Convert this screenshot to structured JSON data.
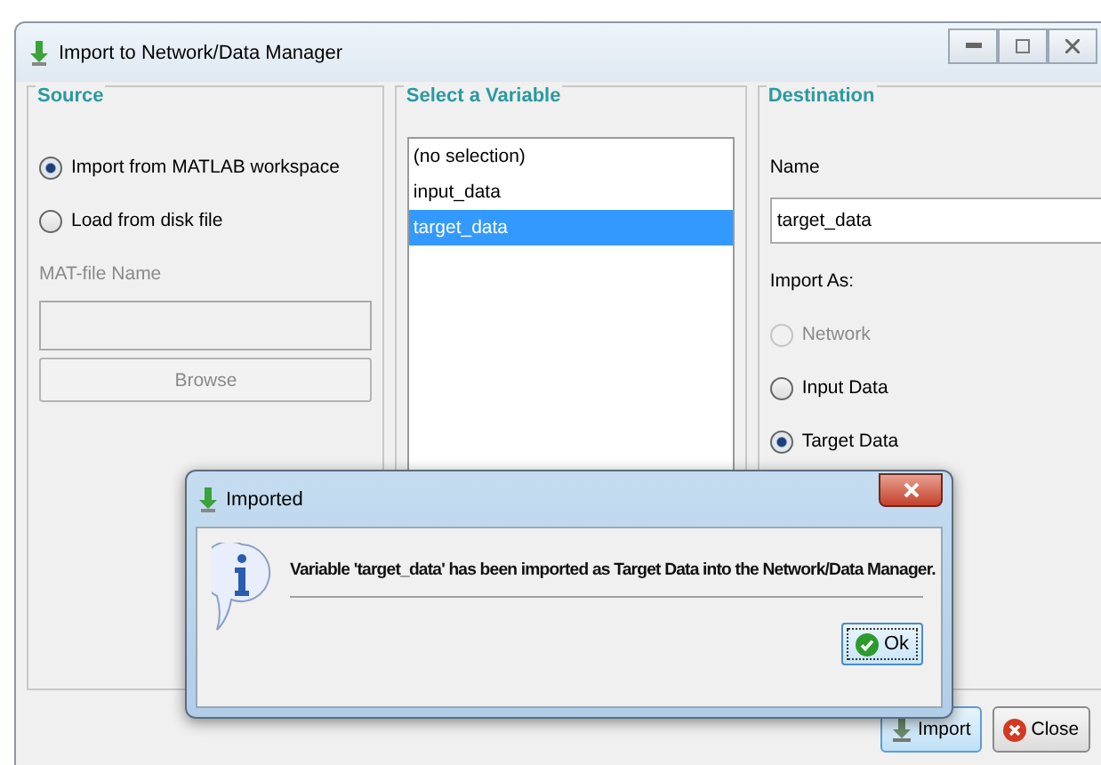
{
  "window": {
    "title": "Import to Network/Data Manager"
  },
  "source": {
    "title": "Source",
    "options": [
      {
        "label": "Import from MATLAB workspace",
        "selected": true,
        "disabled": false
      },
      {
        "label": "Load from disk file",
        "selected": false,
        "disabled": false
      }
    ],
    "file_label": "MAT-file Name",
    "file_disabled": true,
    "browse": "Browse"
  },
  "variables": {
    "title": "Select a Variable",
    "items": [
      {
        "label": "(no selection)",
        "selected": false
      },
      {
        "label": "input_data",
        "selected": false
      },
      {
        "label": "target_data",
        "selected": true
      }
    ]
  },
  "destination": {
    "title": "Destination",
    "name_label": "Name",
    "name_value": "target_data",
    "import_as_label": "Import As:",
    "options": [
      {
        "label": "Network",
        "selected": false,
        "disabled": true
      },
      {
        "label": "Input Data",
        "selected": false,
        "disabled": false
      },
      {
        "label": "Target Data",
        "selected": true,
        "disabled": false
      }
    ]
  },
  "buttons": [
    {
      "label": "Import",
      "kind": "import",
      "default": true
    },
    {
      "label": "Close",
      "kind": "close",
      "default": false
    }
  ],
  "dialog": {
    "title": "Imported",
    "message": "Variable 'target_data' has been imported as Target Data into the Network/Data Manager.",
    "ok": "Ok"
  }
}
